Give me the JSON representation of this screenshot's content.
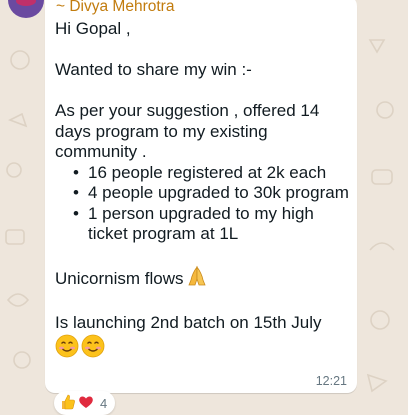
{
  "message": {
    "sender": "~ Divya Mehrotra",
    "greeting": "Hi Gopal ,",
    "intro": "Wanted to share my win :-",
    "suggestion": "As per your suggestion , offered 14 days program to my existing community .",
    "bullets": [
      "16 people registered at 2k each",
      "4 people upgraded to 30k program",
      "1 person upgraded to my high ticket program at 1L"
    ],
    "unicornism": "Unicornism flows",
    "launching": "Is launching 2nd batch on 15th July",
    "time": "12:21"
  },
  "reactions": {
    "count": "4",
    "emojis": [
      "thumbs-up-icon",
      "heart-icon"
    ]
  },
  "colors": {
    "sender": "#c27c0e",
    "background": "#eee6dc",
    "bubble": "#ffffff",
    "time": "#667781"
  }
}
